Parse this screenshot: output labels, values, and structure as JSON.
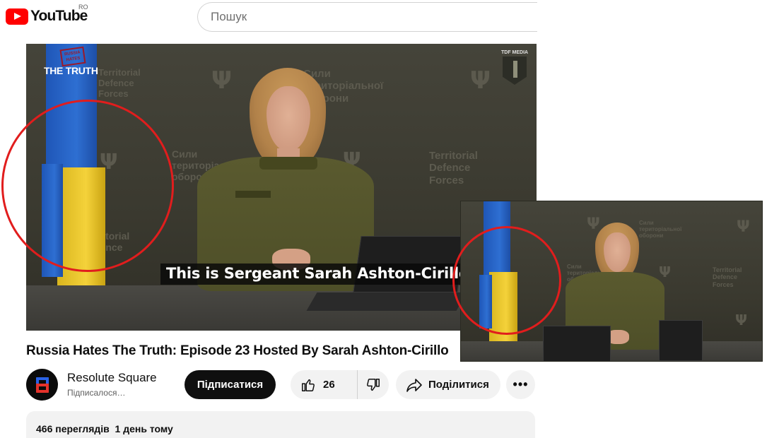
{
  "header": {
    "logo_text": "YouTube",
    "logo_region": "RO",
    "search_placeholder": "Пошук"
  },
  "video": {
    "brand": "THE TRUTH",
    "stamp": "RUSSIA HATES",
    "corner_logo": "TDF MEDIA",
    "caption": "This is Sergeant Sarah Ashton-Cirillo of",
    "wall_text_left_top": "Сили\nтериторіальної\nоборони",
    "wall_text_left_mid": "Сили\nтериторіальної\nоборони",
    "wall_text_right": "Territorial\nDefence\nForces",
    "wall_text_left_low": "Territorial\nDefence",
    "wall_text_left_edge": "Territorial\nDefence\nForces",
    "flag_colors": [
      "#2e6fd2",
      "#f4d23a"
    ],
    "highlight_color": "#e11d1d"
  },
  "small_video": {
    "wall_text_top": "Сили\nтериторіальної\nоборони",
    "wall_text_right": "Territorial\nDefence\nForces",
    "wall_text_left": "Сили\nтериторіальної\nоборони"
  },
  "info": {
    "title": "Russia Hates The Truth: Episode 23 Hosted By Sarah Ashton-Cirillo",
    "channel_name": "Resolute Square",
    "subscription_status": "Підписалося…",
    "subscribe_label": "Підписатися",
    "like_count": "26",
    "share_label": "Поділитися",
    "more_label": "•••",
    "views_line": "466 переглядів  1 день тому"
  },
  "icons": {
    "logo": "youtube-play-icon",
    "like": "thumbs-up-icon",
    "dislike": "thumbs-down-icon",
    "share": "share-arrow-icon",
    "more": "more-horizontal-icon"
  }
}
